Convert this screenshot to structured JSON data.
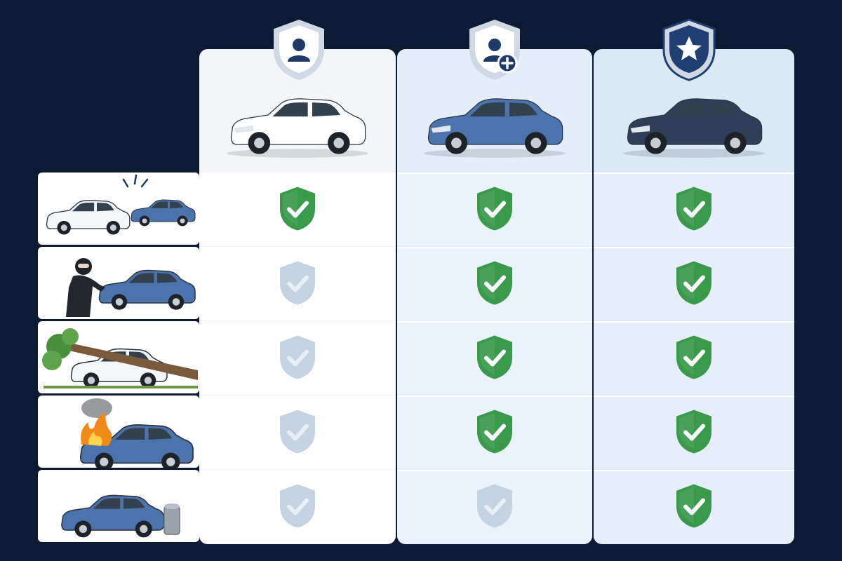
{
  "colors": {
    "background": "#0c1b33",
    "covered": "#3a9a4b",
    "not_covered": "#c5d2e2",
    "badge_outline": "#2a4a75"
  },
  "plans": [
    {
      "key": "basic",
      "badge_icon": "user-shield-icon",
      "car_color": "#ffffff"
    },
    {
      "key": "plus",
      "badge_icon": "user-plus-shield-icon",
      "car_color": "#4b74ad"
    },
    {
      "key": "premium",
      "badge_icon": "star-shield-icon",
      "car_color": "#2f3f57"
    }
  ],
  "risks": [
    {
      "key": "collision",
      "icon": "car-collision-icon"
    },
    {
      "key": "theft",
      "icon": "car-theft-icon"
    },
    {
      "key": "fallen-tree",
      "icon": "fallen-tree-icon"
    },
    {
      "key": "fire",
      "icon": "car-fire-icon"
    },
    {
      "key": "pole-impact",
      "icon": "pole-impact-icon"
    }
  ],
  "coverage": [
    [
      true,
      true,
      true
    ],
    [
      false,
      true,
      true
    ],
    [
      false,
      true,
      true
    ],
    [
      false,
      true,
      true
    ],
    [
      false,
      false,
      true
    ]
  ]
}
